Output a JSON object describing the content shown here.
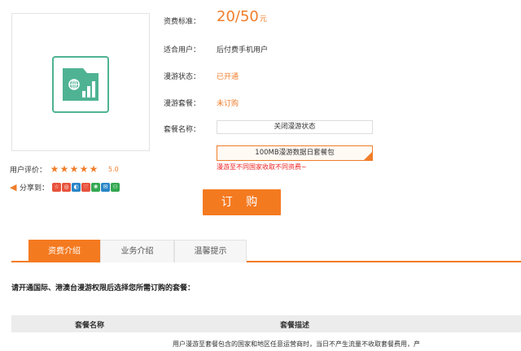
{
  "product": {
    "icon": "sim-chart-icon",
    "price_label": "资费标准：",
    "price_value": "20/50",
    "price_unit": "元",
    "user_label": "适合用户：",
    "user_value": "后付费手机用户",
    "roaming_status_label": "漫游状态：",
    "roaming_status_value": "已开通",
    "roaming_package_label": "漫游套餐：",
    "roaming_package_value": "未订购",
    "package_name_label": "套餐名称：",
    "package_options": [
      "关闭漫游状态",
      "100MB漫游数据日套餐包"
    ],
    "selected_package": "100MB漫游数据日套餐包",
    "warning": "漫游至不同国家收取不同资费~",
    "order_button": "订 购",
    "accent_color": "#f47a20",
    "icon_color": "#4fb393"
  },
  "rating": {
    "label": "用户评价：",
    "stars": 5,
    "score": "5.0"
  },
  "share": {
    "label": "分享到：",
    "icon": "share-icon",
    "sites": [
      {
        "name": "qzone-icon",
        "color": "#e8523c"
      },
      {
        "name": "weibo-icon",
        "color": "#e8523c"
      },
      {
        "name": "renren-icon",
        "color": "#2a86c7"
      },
      {
        "name": "kaixin-icon",
        "color": "#e8523c"
      },
      {
        "name": "douban-icon",
        "color": "#34a852"
      },
      {
        "name": "tencent-weibo-icon",
        "color": "#2a86c7"
      },
      {
        "name": "wechat-icon",
        "color": "#34a852"
      }
    ]
  },
  "tabs": [
    {
      "label": "资费介绍",
      "active": true
    },
    {
      "label": "业务介绍",
      "active": false
    },
    {
      "label": "温馨提示",
      "active": false
    }
  ],
  "content": {
    "intro": "请开通国际、港澳台漫游权限后选择您所需订购的套餐：",
    "table": {
      "headers": [
        "套餐名称",
        "套餐描述"
      ],
      "first_desc": "用户漫游至套餐包含的国家和地区任意运营商时，当日不产生流量不收取套餐费用，产"
    }
  }
}
